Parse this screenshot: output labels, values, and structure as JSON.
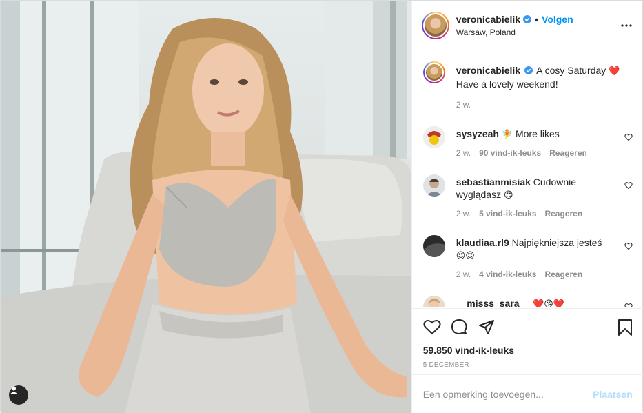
{
  "header": {
    "username": "veronicabielik",
    "separator": "•",
    "follow_label": "Volgen",
    "location": "Warsaw, Poland",
    "more_icon": "more-options-icon"
  },
  "caption": {
    "username": "veronicabielik",
    "text_line1": "A cosy Saturday",
    "heart": "❤️",
    "text_line2": "Have a lovely weekend!",
    "time": "2 w."
  },
  "comments": [
    {
      "username": "sysyzeah",
      "emoji": "🧚",
      "text": "More likes",
      "time": "2 w.",
      "likes": "90 vind-ik-leuks",
      "reply": "Reageren"
    },
    {
      "username": "sebastianmisiak",
      "text": "Cudownie wyglądasz",
      "emoji": "😍",
      "time": "2 w.",
      "likes": "5 vind-ik-leuks",
      "reply": "Reageren"
    },
    {
      "username": "klaudiaa.rl9",
      "text": "Najpiękniejsza jesteś",
      "emoji": "😍😍",
      "time": "2 w.",
      "likes": "4 vind-ik-leuks",
      "reply": "Reageren"
    },
    {
      "username": "__misss_sara__",
      "emoji": "❤️😘❤️"
    }
  ],
  "actions": {
    "likes_count": "59.850 vind-ik-leuks",
    "date": "5 DECEMBER"
  },
  "add_comment": {
    "placeholder": "Een opmerking toevoegen...",
    "post_label": "Plaatsen"
  },
  "colors": {
    "accent": "#0095f6",
    "post_disabled": "#b2dffc",
    "muted": "#8e8e8e"
  }
}
